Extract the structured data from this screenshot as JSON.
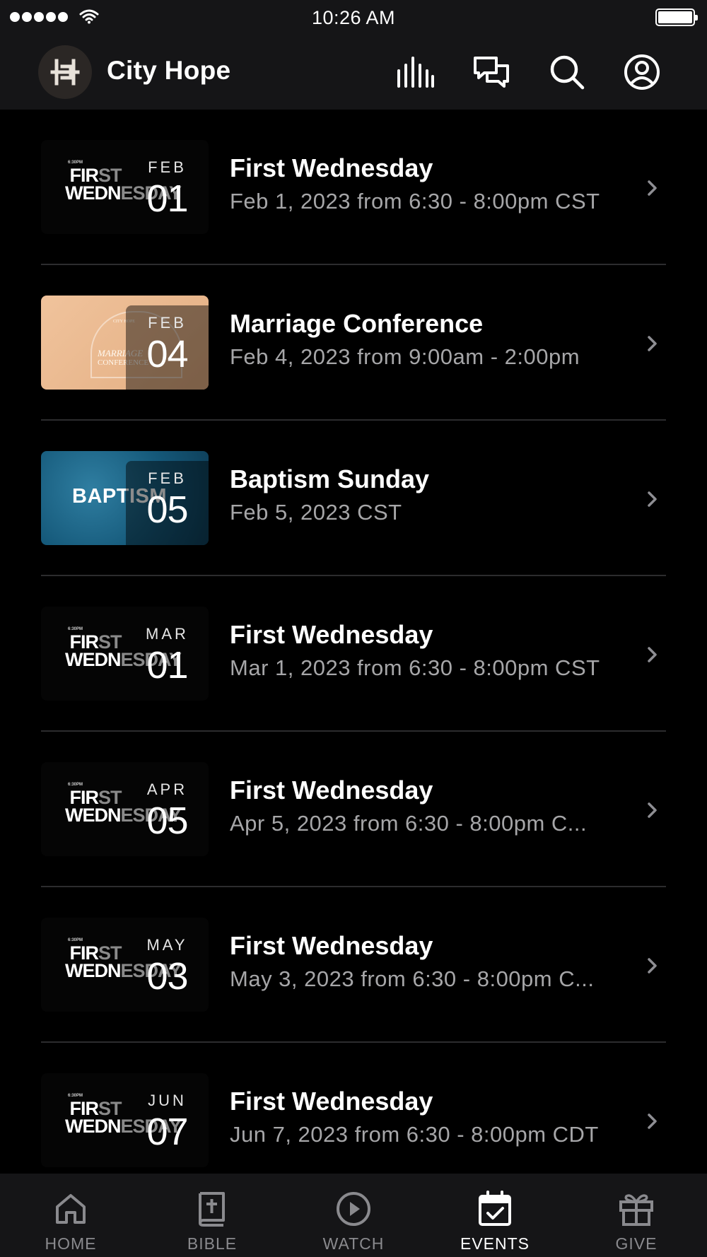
{
  "status_bar": {
    "time": "10:26 AM",
    "icons": [
      "signal-dots-icon",
      "wifi-icon",
      "battery-icon"
    ]
  },
  "header": {
    "logo_icon": "city-hope-logo-icon",
    "title": "City Hope",
    "actions": [
      "audio-bars-icon",
      "chat-icon",
      "search-icon",
      "profile-icon"
    ]
  },
  "events": [
    {
      "thumb": "first-wednesday",
      "month": "FEB",
      "day": "01",
      "title": "First Wednesday",
      "subtitle": "Feb 1, 2023 from 6:30 - 8:00pm CST"
    },
    {
      "thumb": "marriage",
      "month": "FEB",
      "day": "04",
      "title": "Marriage Conference",
      "subtitle": "Feb 4, 2023 from 9:00am - 2:00pm"
    },
    {
      "thumb": "baptism",
      "month": "FEB",
      "day": "05",
      "title": "Baptism Sunday",
      "subtitle": "Feb 5, 2023 CST"
    },
    {
      "thumb": "first-wednesday",
      "month": "MAR",
      "day": "01",
      "title": "First Wednesday",
      "subtitle": "Mar 1, 2023 from 6:30 - 8:00pm CST"
    },
    {
      "thumb": "first-wednesday",
      "month": "APR",
      "day": "05",
      "title": "First Wednesday",
      "subtitle": "Apr 5, 2023 from 6:30 - 8:00pm C..."
    },
    {
      "thumb": "first-wednesday",
      "month": "MAY",
      "day": "03",
      "title": "First Wednesday",
      "subtitle": "May 3, 2023 from 6:30 - 8:00pm C..."
    },
    {
      "thumb": "first-wednesday",
      "month": "JUN",
      "day": "07",
      "title": "First Wednesday",
      "subtitle": "Jun 7, 2023 from 6:30 - 8:00pm CDT"
    }
  ],
  "thumb_art": {
    "first_wednesday": {
      "line1a": "FIR",
      "line1b": "ST",
      "line2a": "WEDN",
      "line2b": "ESDAY",
      "caption": "6:30PM"
    },
    "marriage": {
      "caption": "CITY HOPE",
      "line1": "MARRIAGE",
      "line2": "CONFERENCE"
    },
    "baptism": {
      "word": "BAPTISM"
    }
  },
  "tabs": [
    {
      "label": "HOME",
      "icon": "home-icon",
      "active": false
    },
    {
      "label": "BIBLE",
      "icon": "bible-icon",
      "active": false
    },
    {
      "label": "WATCH",
      "icon": "play-circle-icon",
      "active": false
    },
    {
      "label": "EVENTS",
      "icon": "calendar-check-icon",
      "active": true
    },
    {
      "label": "GIVE",
      "icon": "gift-icon",
      "active": false
    }
  ]
}
